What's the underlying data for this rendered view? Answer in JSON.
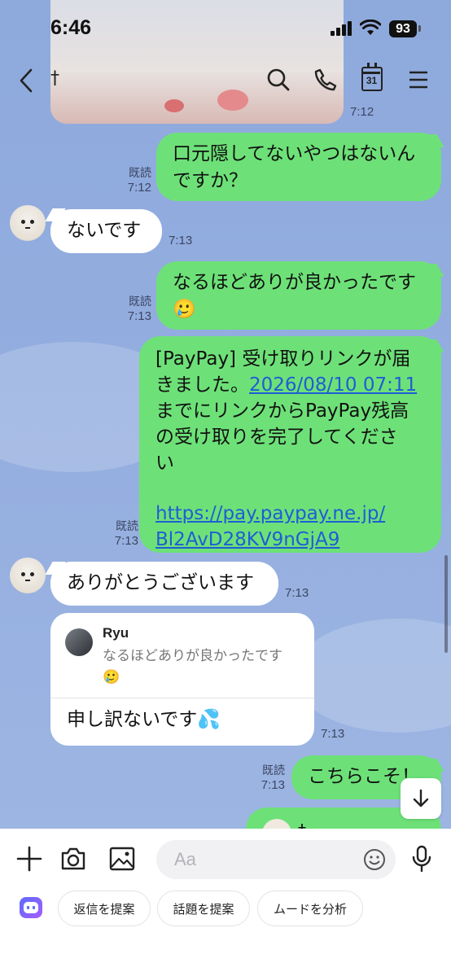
{
  "status_bar": {
    "time": "6:46",
    "battery": "93"
  },
  "header": {
    "contact_name": "†",
    "calendar_day": "31"
  },
  "photo_timestamp": "7:12",
  "messages": [
    {
      "id": "m1",
      "dir": "sent",
      "lines": [
        "口元隠してないやつはないん",
        "ですか？"
      ],
      "read": "既読",
      "time": "7:12"
    },
    {
      "id": "m2",
      "dir": "recv",
      "text": "ないです",
      "time": "7:13"
    },
    {
      "id": "m3",
      "dir": "sent",
      "lines": [
        "なるほどありが良かったです",
        "🥲"
      ],
      "read": "既読",
      "time": "7:13"
    },
    {
      "id": "m4",
      "dir": "sent",
      "line1": "[PayPay] 受け取りリンクが届",
      "line2_prefix": "きました。",
      "date_link": "2026/08/10 07:11",
      "line3": "までにリンクからPayPay残高",
      "line4": "の受け取りを完了してくださ",
      "line5": "い",
      "url_line1": "https://pay.paypay.ne.jp/",
      "url_line2": "Bl2AvD28KV9nGjA9",
      "read": "既読",
      "time": "7:13"
    },
    {
      "id": "m5",
      "dir": "recv",
      "text": "ありがとうございます",
      "time": "7:13"
    },
    {
      "id": "m6",
      "dir": "recv",
      "reply_to_name": "Ryu",
      "reply_to_lines": [
        "なるほどありが良かったです",
        "🥲"
      ],
      "text": "申し訳ないです💦",
      "time": "7:13"
    },
    {
      "id": "m7",
      "dir": "sent",
      "text": "こちらこそ！",
      "read": "既読",
      "time": "7:13"
    },
    {
      "id": "m8",
      "dir": "sent",
      "text": "†"
    }
  ],
  "composer": {
    "placeholder": "Aa"
  },
  "suggestions": [
    "返信を提案",
    "話題を提案",
    "ムードを分析"
  ],
  "colors": {
    "sent_bubble": "#6de178",
    "recv_bubble": "#ffffff",
    "chat_bg": "#8ea9dc",
    "link": "#1f5dd6"
  }
}
